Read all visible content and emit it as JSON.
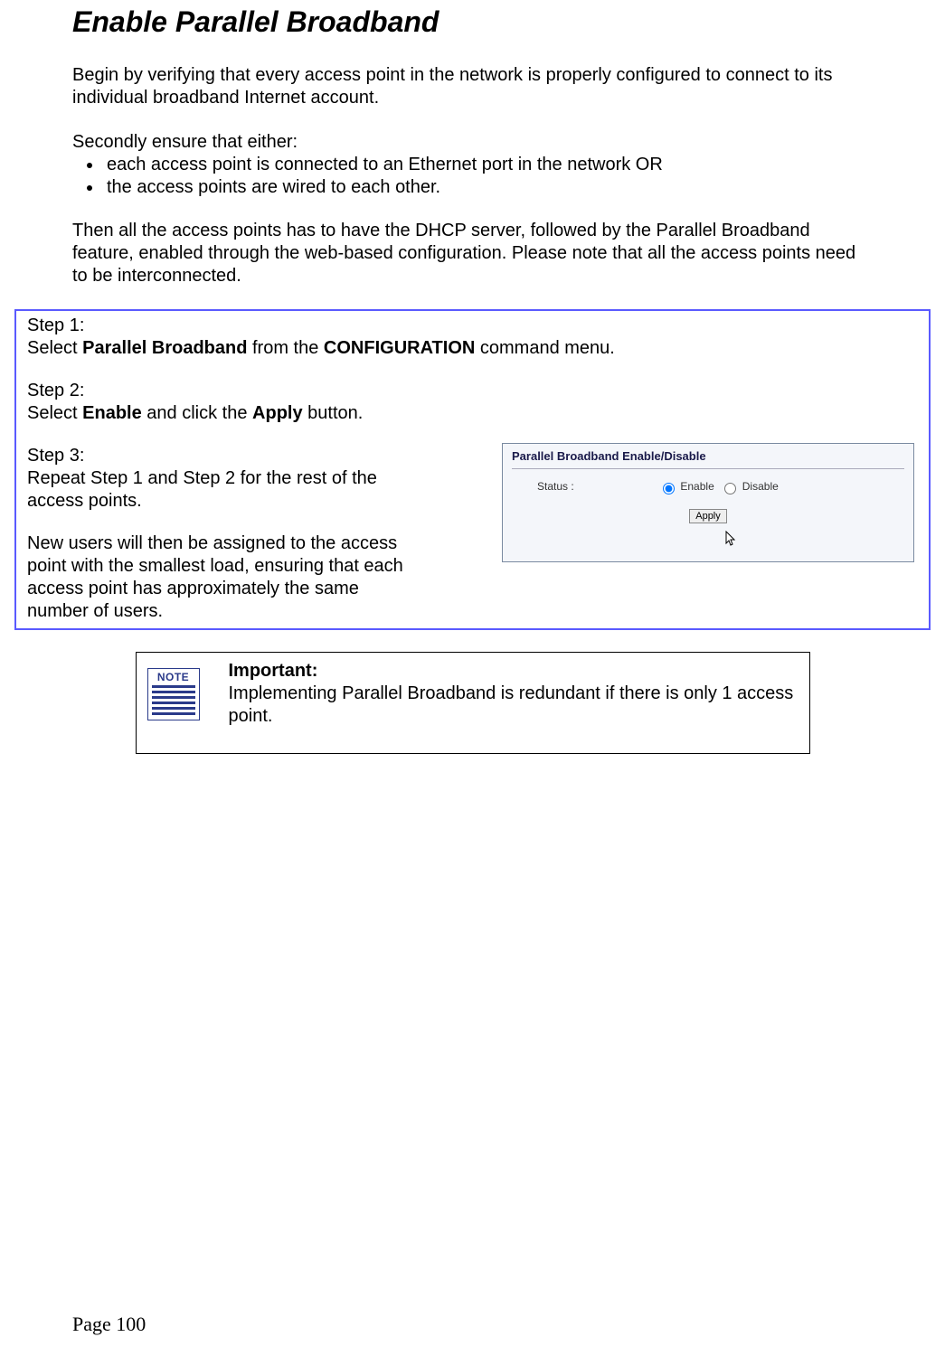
{
  "title": "Enable Parallel Broadband",
  "intro_p1": "Begin by verifying that every access point in the network is properly configured to connect to its individual broadband Internet account.",
  "intro_p2_lead": "Secondly ensure that either:",
  "bullets": [
    "each access point is connected to an Ethernet port in the network OR",
    "the access points are wired to each other."
  ],
  "intro_p3": "Then all the access points has to have the DHCP server, followed by the Parallel Broadband feature, enabled through the web-based configuration. Please note that all the access points need to be interconnected.",
  "steps": {
    "s1_label": "Step 1:",
    "s1_a": "Select ",
    "s1_b": "Parallel Broadband",
    "s1_c": " from the ",
    "s1_d": "CONFIGURATION",
    "s1_e": " command menu.",
    "s2_label": "Step 2:",
    "s2_a": "Select ",
    "s2_b": "Enable",
    "s2_c": " and click the ",
    "s2_d": "Apply",
    "s2_e": " button.",
    "s3_label": "Step 3:",
    "s3_body": "Repeat Step 1 and Step 2 for the rest of the access points.",
    "closing": "New users will then be assigned to the access point with the smallest load, ensuring that each access point has approximately the same number of users."
  },
  "widget": {
    "title": "Parallel Broadband Enable/Disable",
    "status_label": "Status :",
    "enable_label": "Enable",
    "disable_label": "Disable",
    "apply_label": "Apply"
  },
  "note": {
    "icon_label": "NOTE",
    "important": "Important:",
    "text": "Implementing Parallel Broadband is redundant if there is only 1 access point."
  },
  "footer": "Page 100"
}
